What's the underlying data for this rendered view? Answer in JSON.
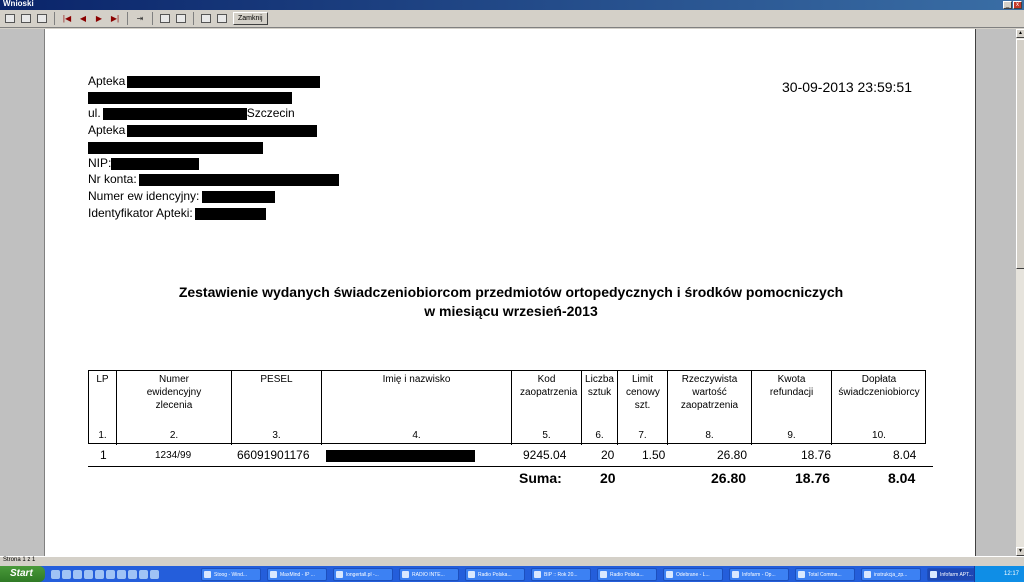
{
  "window": {
    "title": "Wnioski"
  },
  "toolbar": {
    "close_label": "Zamknij"
  },
  "header": {
    "lines": [
      {
        "prefix": "Apteka",
        "suffix": ""
      },
      {
        "prefix": "",
        "suffix": ""
      },
      {
        "prefix": "ul.",
        "suffix": "Szczecin"
      },
      {
        "prefix": "Apteka",
        "suffix": ""
      },
      {
        "prefix": "",
        "suffix": ""
      },
      {
        "prefix": "NIP:",
        "suffix": ""
      },
      {
        "prefix": "Nr konta:",
        "suffix": ""
      },
      {
        "prefix": "Numer ew idencyjny:",
        "suffix": ""
      },
      {
        "prefix": "Identyfikator Apteki:",
        "suffix": ""
      }
    ],
    "timestamp": "30-09-2013 23:59:51"
  },
  "report": {
    "title_line1": "Zestawienie wydanych świadczeniobiorcom przedmiotów ortopedycznych i środków pomocniczych",
    "title_line2": "w miesiącu wrzesień-2013"
  },
  "table": {
    "columns": [
      {
        "label": "LP",
        "num": "1."
      },
      {
        "label": "Numer ewidencyjny zlecenia",
        "num": "2."
      },
      {
        "label": "PESEL",
        "num": "3."
      },
      {
        "label": "Imię i nazwisko",
        "num": "4."
      },
      {
        "label": "Kod zaopatrzenia",
        "num": "5."
      },
      {
        "label": "Liczba sztuk",
        "num": "6."
      },
      {
        "label": "Limit cenowy szt.",
        "num": "7."
      },
      {
        "label": "Rzeczywista wartość zaopatrzenia",
        "num": "8."
      },
      {
        "label": "Kwota refundacji",
        "num": "9."
      },
      {
        "label": "Dopłata świadczeniobiorcy",
        "num": "10."
      }
    ],
    "row": {
      "lp": "1",
      "numer": "1234/99",
      "pesel": "66091901176",
      "kod": "9245.04",
      "liczba": "20",
      "limit": "1.50",
      "wartosc": "26.80",
      "refundacja": "18.76",
      "doplata": "8.04"
    },
    "sum": {
      "label": "Suma:",
      "liczba": "20",
      "wartosc": "26.80",
      "refundacja": "18.76",
      "doplata": "8.04"
    }
  },
  "statusbar": {
    "text": "Strona 1 z 1"
  },
  "taskbar": {
    "start_label": "Start",
    "tasks": [
      "Stoog - Wind...",
      "MaxMind - IP ...",
      "longertall.pl -...",
      "RADIO INTE...",
      "Radio Polska...",
      "BIP :: Rok 20...",
      "Radio Polska...",
      "Odebrane - L...",
      "Infofarm - Op...",
      "Total Comma...",
      "instrukcja_zp...",
      "Infofarm APT..."
    ],
    "clock": "12:17"
  }
}
